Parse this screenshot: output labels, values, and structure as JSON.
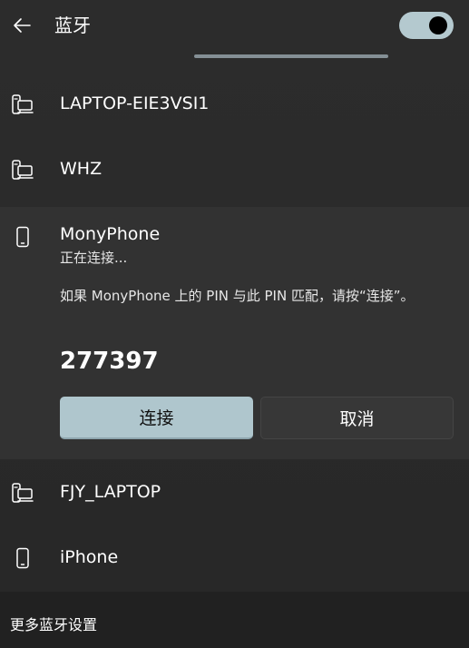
{
  "header": {
    "title": "蓝牙",
    "toggle_state": "on",
    "toggle_color": "#b4c9cf"
  },
  "devices": [
    {
      "name": "LAPTOP-EIE3VSI1",
      "icon": "laptop-icon"
    },
    {
      "name": "WHZ",
      "icon": "laptop-icon"
    },
    {
      "name": "MonyPhone",
      "icon": "phone-icon"
    },
    {
      "name": "FJY_LAPTOP",
      "icon": "laptop-icon"
    },
    {
      "name": "iPhone",
      "icon": "phone-icon"
    }
  ],
  "pairing": {
    "status": "正在连接...",
    "message": "如果 MonyPhone 上的 PIN 与此 PIN 匹配，请按“连接”。",
    "pin": "277397",
    "connect_label": "连接",
    "cancel_label": "取消"
  },
  "footer": {
    "link_label": "更多蓝牙设置"
  },
  "colors": {
    "accent": "#afc6cd",
    "background": "#2b2b2b",
    "expanded_background": "#323232",
    "footer_background": "#212121"
  }
}
